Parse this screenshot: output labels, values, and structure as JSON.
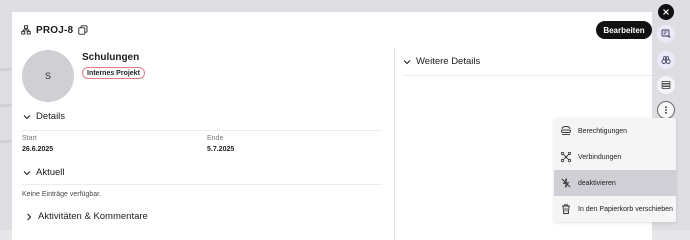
{
  "header": {
    "project_id": "PROJ-8",
    "edit_label": "Bearbeiten"
  },
  "profile": {
    "avatar_initial": "S",
    "title": "Schulungen",
    "badge": "Internes Projekt"
  },
  "details": {
    "heading": "Details",
    "start_label": "Start",
    "start_value": "26.6.2025",
    "end_label": "Ende",
    "end_value": "5.7.2025"
  },
  "current": {
    "heading": "Aktuell",
    "empty_text": "Keine Einträge verfügbar."
  },
  "activities": {
    "heading": "Aktivitäten & Kommentare"
  },
  "more_details": {
    "heading": "Weitere Details"
  },
  "context_menu": {
    "items": [
      {
        "label": "Berechtigungen",
        "icon": "permissions-icon"
      },
      {
        "label": "Verbindungen",
        "icon": "connections-icon"
      },
      {
        "label": "deaktivieren",
        "icon": "deactivate-icon"
      },
      {
        "label": "In den Papierkorb verschieben",
        "icon": "trash-icon"
      }
    ]
  },
  "colors": {
    "accent_dark": "#111114",
    "badge_border": "#e07b8c",
    "menu_hover": "#cfcfd5"
  }
}
